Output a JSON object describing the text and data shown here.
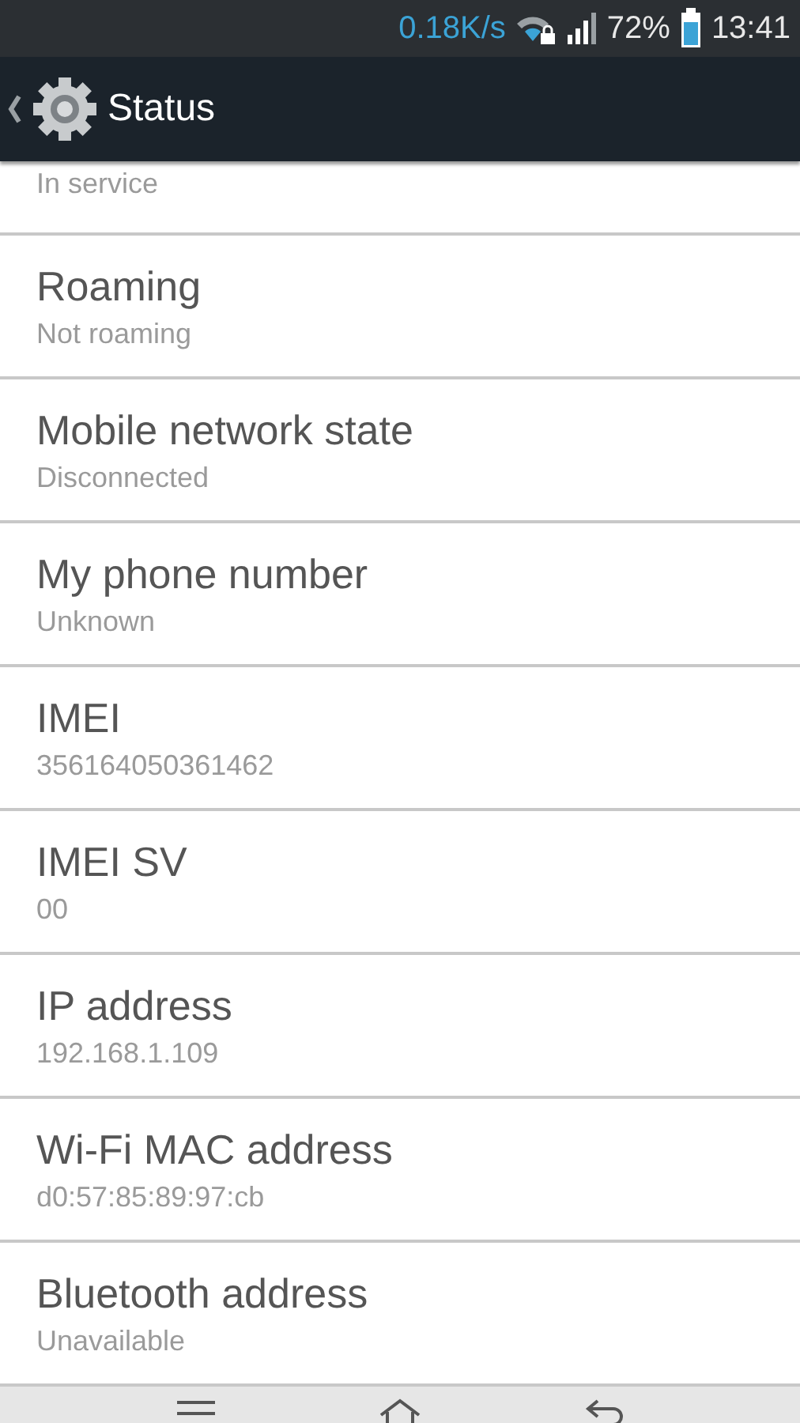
{
  "status_bar": {
    "network_speed": "0.18K/s",
    "battery_percent": "72%",
    "time": "13:41"
  },
  "action_bar": {
    "title": "Status"
  },
  "items": [
    {
      "kind": "partial",
      "value": "In service"
    },
    {
      "kind": "full",
      "title": "Roaming",
      "value": "Not roaming"
    },
    {
      "kind": "full",
      "title": "Mobile network state",
      "value": "Disconnected"
    },
    {
      "kind": "full",
      "title": "My phone number",
      "value": "Unknown"
    },
    {
      "kind": "full",
      "title": "IMEI",
      "value": "356164050361462"
    },
    {
      "kind": "full",
      "title": "IMEI SV",
      "value": "00"
    },
    {
      "kind": "full",
      "title": "IP address",
      "value": "192.168.1.109"
    },
    {
      "kind": "full",
      "title": "Wi-Fi MAC address",
      "value": "d0:57:85:89:97:cb"
    },
    {
      "kind": "full",
      "title": "Bluetooth address",
      "value": "Unavailable"
    }
  ]
}
